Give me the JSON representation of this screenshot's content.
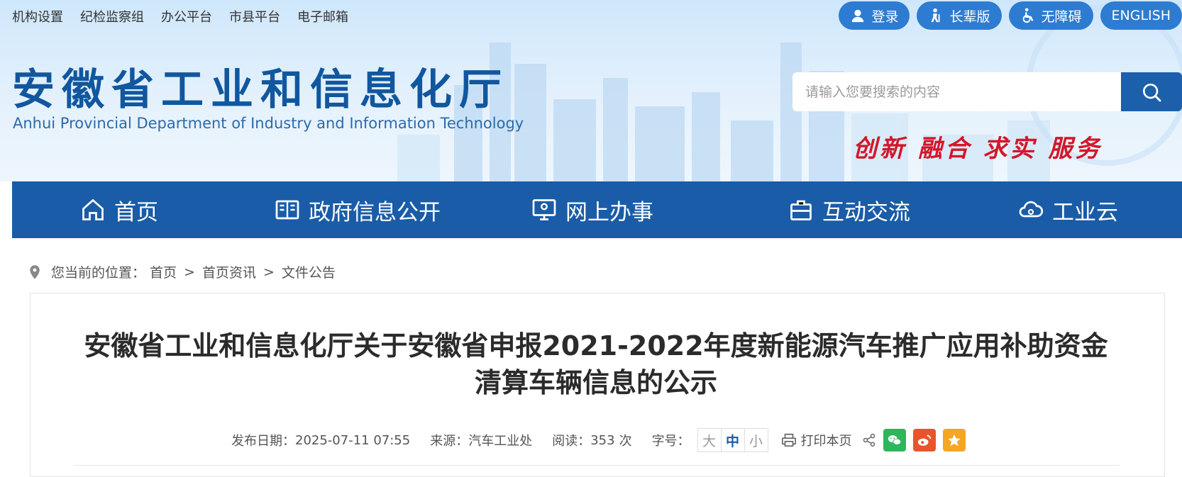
{
  "top_links": [
    "机构设置",
    "纪检监察组",
    "办公平台",
    "市县平台",
    "电子邮箱"
  ],
  "pills": {
    "login": "登录",
    "elder": "长辈版",
    "accessible": "无障碍",
    "english": "ENGLISH"
  },
  "site": {
    "title_cn": "安徽省工业和信息化厅",
    "title_en": "Anhui Provincial Department of Industry and Information Technology",
    "slogan": "创新 融合 求实 服务"
  },
  "search": {
    "placeholder": "请输入您要搜索的内容"
  },
  "nav": {
    "home": "首页",
    "gov_info": "政府信息公开",
    "online_service": "网上办事",
    "interaction": "互动交流",
    "industry_cloud": "工业云"
  },
  "breadcrumb": {
    "prefix": "您当前的位置：",
    "items": [
      "首页",
      "首页资讯",
      "文件公告"
    ],
    "separator": ">"
  },
  "article": {
    "title": "安徽省工业和信息化厅关于安徽省申报2021-2022年度新能源汽车推广应用补助资金清算车辆信息的公示",
    "date_label": "发布日期：",
    "date": "2025-07-11 07:55",
    "source_label": "来源：",
    "source": "汽车工业处",
    "views_label": "阅读：",
    "views": "353",
    "views_unit": "次",
    "fontsize_label": "字号：",
    "fontsize_options": [
      "大",
      "中",
      "小"
    ],
    "print_label": "打印本页"
  },
  "colors": {
    "nav_bg": "#1a5ca7",
    "pill_bg": "#2e7cd1",
    "slogan": "#d4162a",
    "wechat": "#2fb55a",
    "weibo": "#e8552b",
    "favorite": "#f5a623"
  }
}
